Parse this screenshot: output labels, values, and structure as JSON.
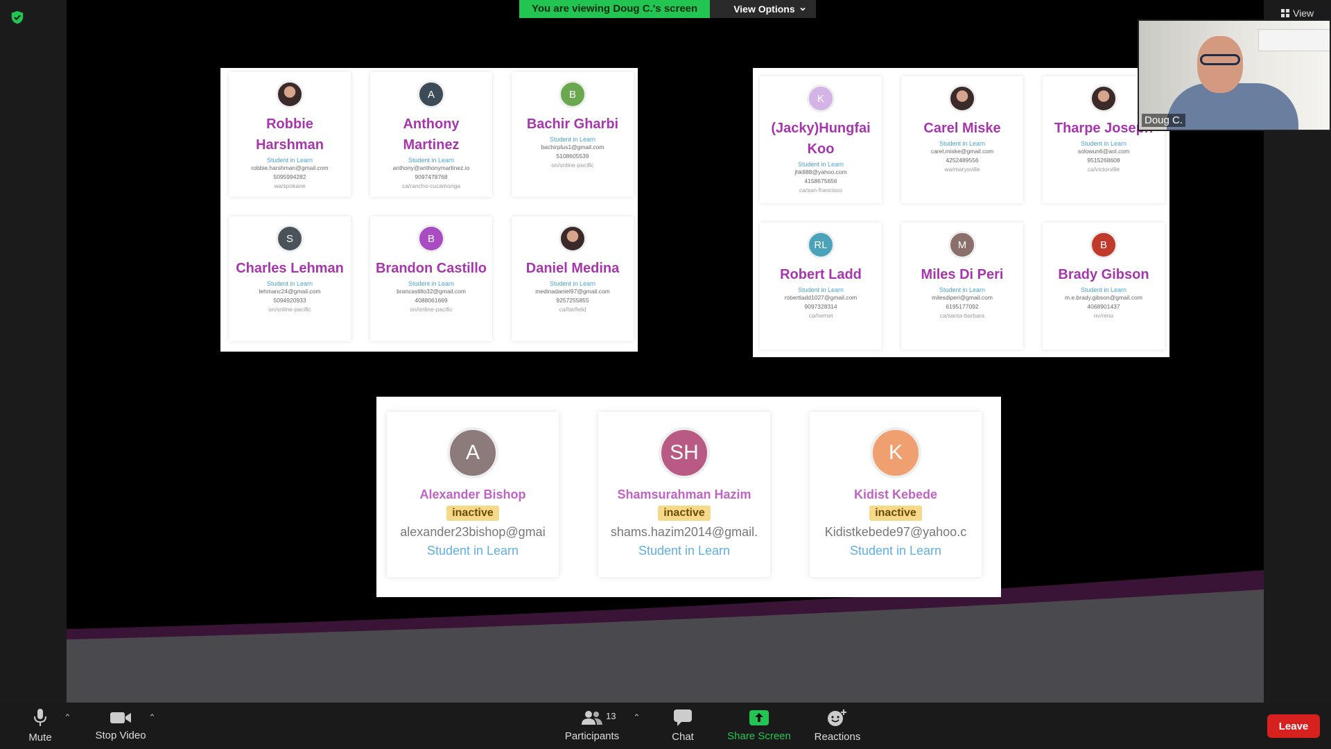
{
  "banner": {
    "text": "You are viewing Doug C.'s screen",
    "view_options": "View Options"
  },
  "top_right": {
    "view_label": "View"
  },
  "self_view": {
    "name": "Doug C."
  },
  "panel1": [
    {
      "name": "Robbie Harshman",
      "role": "Student in Learn",
      "email": "robbie.harshman@gmail.com",
      "phone": "5095994282",
      "loc": "wa/spokane",
      "avatar": "",
      "color": ""
    },
    {
      "name": "Anthony Martinez",
      "role": "Student in Learn",
      "email": "anthony@anthonymartinez.io",
      "phone": "9097478768",
      "loc": "ca/rancho-cucamonga",
      "avatar": "A",
      "color": "#3d4a57"
    },
    {
      "name": "Bachir Gharbi",
      "role": "Student in Learn",
      "email": "bachirplus1@gmail.com",
      "phone": "5108605539",
      "loc": "on/online-pacific",
      "avatar": "B",
      "color": "#6aa84f"
    },
    {
      "name": "Charles Lehman",
      "role": "Student in Learn",
      "email": "lehmanc24@gmail.com",
      "phone": "5094920933",
      "loc": "on/online-pacific",
      "avatar": "S",
      "color": "#4a525a"
    },
    {
      "name": "Brandon Castillo",
      "role": "Student in Learn",
      "email": "brancastillo32@gmail.com",
      "phone": "4088061669",
      "loc": "on/online-pacific",
      "avatar": "B",
      "color": "#a94bc1"
    },
    {
      "name": "Daniel Medina",
      "role": "Student in Learn",
      "email": "medinadaniel97@gmail.com",
      "phone": "9257255855",
      "loc": "ca/fairfield",
      "avatar": "",
      "color": ""
    }
  ],
  "panel2": [
    {
      "name": "(Jacky)Hungfai Koo",
      "role": "Student in Learn",
      "email": "jhk888@yahoo.com",
      "phone": "4158675656",
      "loc": "ca/san-francisco",
      "avatar": "K",
      "color": "#d4b4e6"
    },
    {
      "name": "Carel Miske",
      "role": "Student in Learn",
      "email": "carel.miske@gmail.com",
      "phone": "4252489556",
      "loc": "wa/marysville",
      "avatar": "",
      "color": ""
    },
    {
      "name": "Tharpe Joseph",
      "role": "Student in Learn",
      "email": "solowun6@aol.com",
      "phone": "9515268608",
      "loc": "ca/victorville",
      "avatar": "",
      "color": ""
    },
    {
      "name": "Robert Ladd",
      "role": "Student in Learn",
      "email": "robertladd1027@gmail.com",
      "phone": "9097328314",
      "loc": "ca/hemet",
      "avatar": "RL",
      "color": "#4aa3b8"
    },
    {
      "name": "Miles Di Peri",
      "role": "Student in Learn",
      "email": "milesdiperi@gmail.com",
      "phone": "6195177092",
      "loc": "ca/santa-barbara",
      "avatar": "M",
      "color": "#8a6f6a"
    },
    {
      "name": "Brady Gibson",
      "role": "Student in Learn",
      "email": "m.e.brady.gibson@gmail.com",
      "phone": "4068901437",
      "loc": "nv/reno",
      "avatar": "B",
      "color": "#c0392b"
    }
  ],
  "panel3": [
    {
      "name": "Alexander Bishop",
      "status": "inactive",
      "email": "alexander23bishop@gmai",
      "role": "Student in Learn",
      "avatar": "A",
      "color": "#8d7b7b"
    },
    {
      "name": "Shamsurahman Hazim",
      "status": "inactive",
      "email": "shams.hazim2014@gmail.",
      "role": "Student in Learn",
      "avatar": "SH",
      "color": "#b85a83"
    },
    {
      "name": "Kidist Kebede",
      "status": "inactive",
      "email": "Kidistkebede97@yahoo.c",
      "role": "Student in Learn",
      "avatar": "K",
      "color": "#f0a070"
    }
  ],
  "toolbar": {
    "mute": "Mute",
    "stop_video": "Stop Video",
    "participants": "Participants",
    "participants_count": "13",
    "chat": "Chat",
    "share_screen": "Share Screen",
    "reactions": "Reactions",
    "leave": "Leave"
  },
  "colors": {
    "banner_green": "#23c552",
    "leave_red": "#d6211f",
    "name_purple": "#a636ab"
  }
}
